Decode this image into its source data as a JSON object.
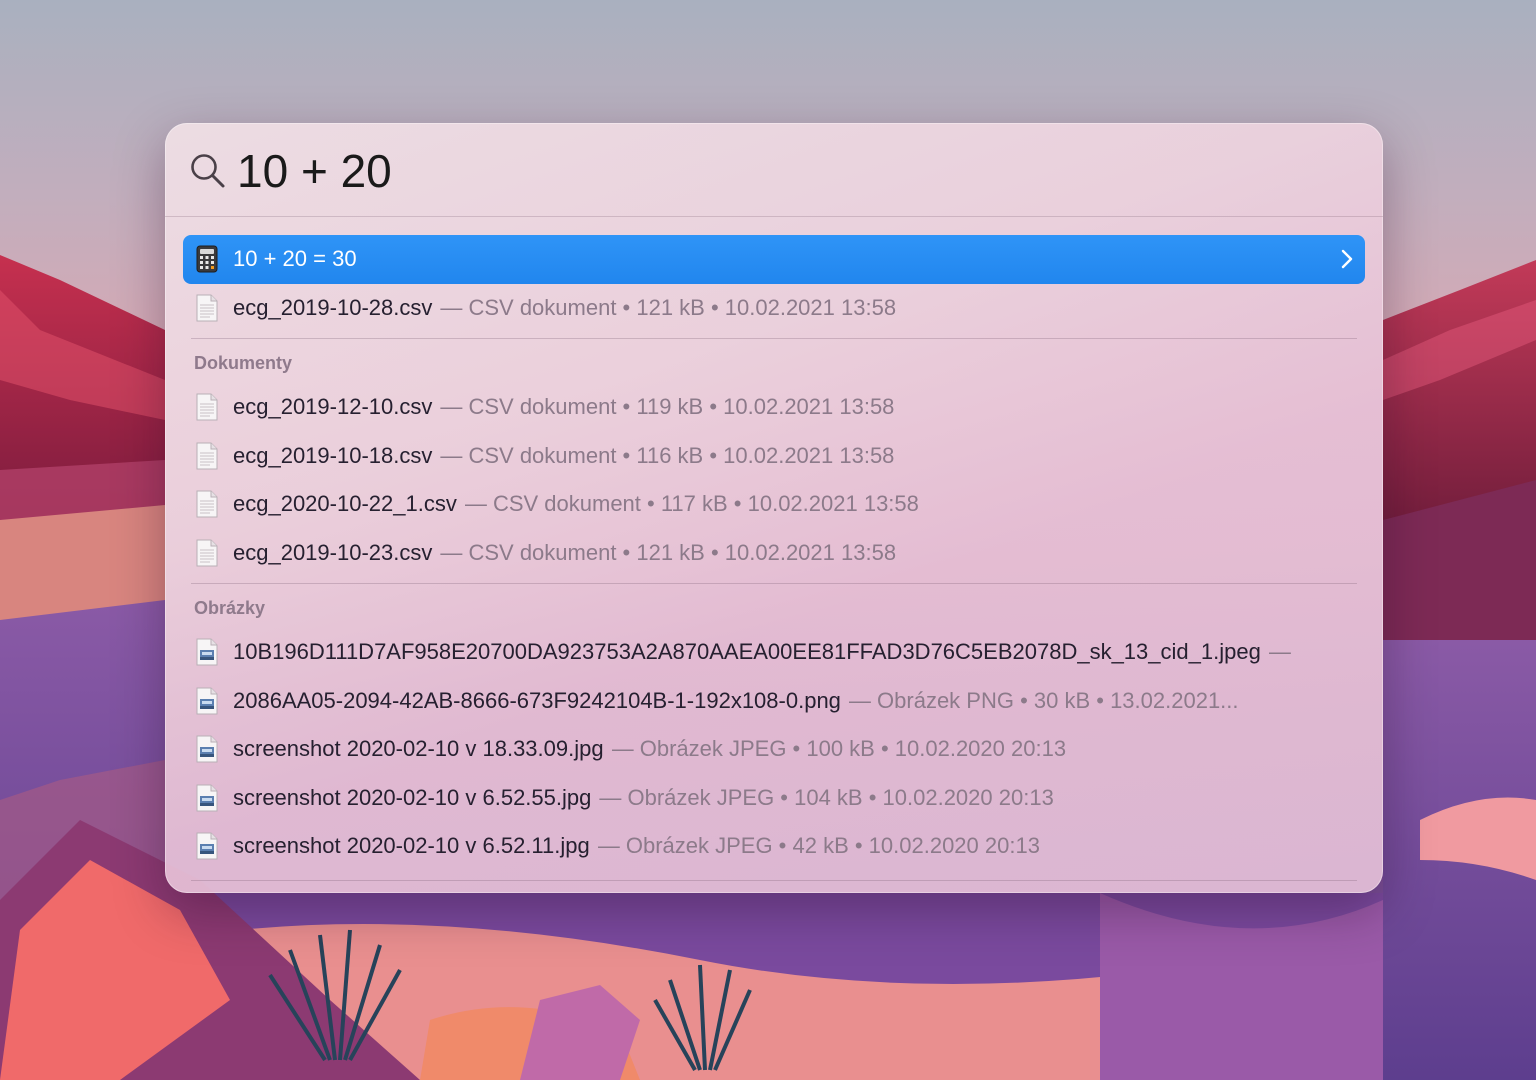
{
  "search": {
    "query": "10 + 20"
  },
  "top_hit": {
    "label": "10 + 20 = 30",
    "icon": "calculator-icon"
  },
  "top_results": [
    {
      "name": "ecg_2019-10-28.csv",
      "meta": "— CSV dokument • 121 kB • 10.02.2021 13:58",
      "icon": "document-icon"
    }
  ],
  "sections": [
    {
      "title": "Dokumenty",
      "items": [
        {
          "name": "ecg_2019-12-10.csv",
          "meta": "— CSV dokument • 119 kB • 10.02.2021 13:58",
          "icon": "document-icon"
        },
        {
          "name": "ecg_2019-10-18.csv",
          "meta": "— CSV dokument • 116 kB • 10.02.2021 13:58",
          "icon": "document-icon"
        },
        {
          "name": "ecg_2020-10-22_1.csv",
          "meta": "— CSV dokument • 117 kB • 10.02.2021 13:58",
          "icon": "document-icon"
        },
        {
          "name": "ecg_2019-10-23.csv",
          "meta": "— CSV dokument • 121 kB • 10.02.2021 13:58",
          "icon": "document-icon"
        }
      ]
    },
    {
      "title": "Obrázky",
      "items": [
        {
          "name": "10B196D111D7AF958E20700DA923753A2A870AAEA00EE81FFAD3D76C5EB2078D_sk_13_cid_1.jpeg",
          "meta": "—",
          "icon": "image-file-icon"
        },
        {
          "name": "2086AA05-2094-42AB-8666-673F9242104B-1-192x108-0.png",
          "meta": "— Obrázek PNG • 30 kB • 13.02.2021...",
          "icon": "image-file-icon"
        },
        {
          "name": "screenshot 2020-02-10 v 18.33.09.jpg",
          "meta": "— Obrázek JPEG • 100 kB • 10.02.2020 20:13",
          "icon": "image-file-icon"
        },
        {
          "name": "screenshot 2020-02-10 v 6.52.55.jpg",
          "meta": "— Obrázek JPEG • 104 kB • 10.02.2020 20:13",
          "icon": "image-file-icon"
        },
        {
          "name": "screenshot 2020-02-10 v 6.52.11.jpg",
          "meta": "— Obrázek JPEG • 42 kB • 10.02.2020 20:13",
          "icon": "image-file-icon"
        }
      ]
    }
  ],
  "colors": {
    "selection": "#2186ee",
    "section_header": "#8f7a8c",
    "meta_text": "#8c7a8a"
  }
}
